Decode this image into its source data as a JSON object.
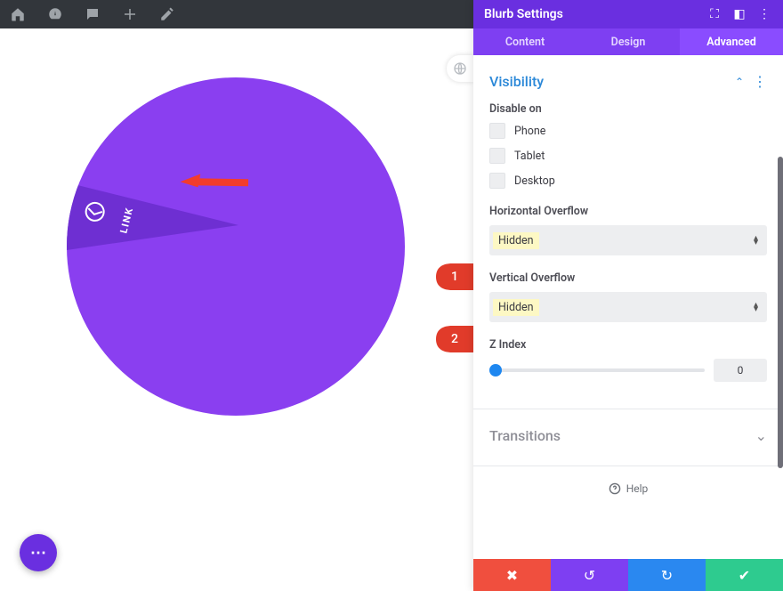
{
  "panel": {
    "title": "Blurb Settings",
    "tabs": {
      "content": "Content",
      "design": "Design",
      "advanced": "Advanced"
    }
  },
  "visibility": {
    "section_title": "Visibility",
    "disable_on_label": "Disable on",
    "phone": "Phone",
    "tablet": "Tablet",
    "desktop": "Desktop",
    "horizontal_overflow_label": "Horizontal Overflow",
    "horizontal_overflow_value": "Hidden",
    "vertical_overflow_label": "Vertical Overflow",
    "vertical_overflow_value": "Hidden",
    "z_index_label": "Z Index",
    "z_index_value": "0"
  },
  "transitions": {
    "section_title": "Transitions"
  },
  "help": {
    "label": "Help"
  },
  "canvas": {
    "link_label": "LINK"
  },
  "callouts": {
    "one": "1",
    "two": "2"
  },
  "icons": {
    "home": "home-icon",
    "gauge": "gauge-icon",
    "comment": "comment-icon",
    "plus": "plus-icon",
    "pencil": "pencil-icon",
    "divi": "✱",
    "globe": "globe-icon",
    "expand": "⛶",
    "columns": "◧",
    "kebab": "⋮",
    "close": "✖",
    "undo": "↺",
    "redo": "↻",
    "check": "✔",
    "help": "?",
    "fab": "⋯"
  }
}
